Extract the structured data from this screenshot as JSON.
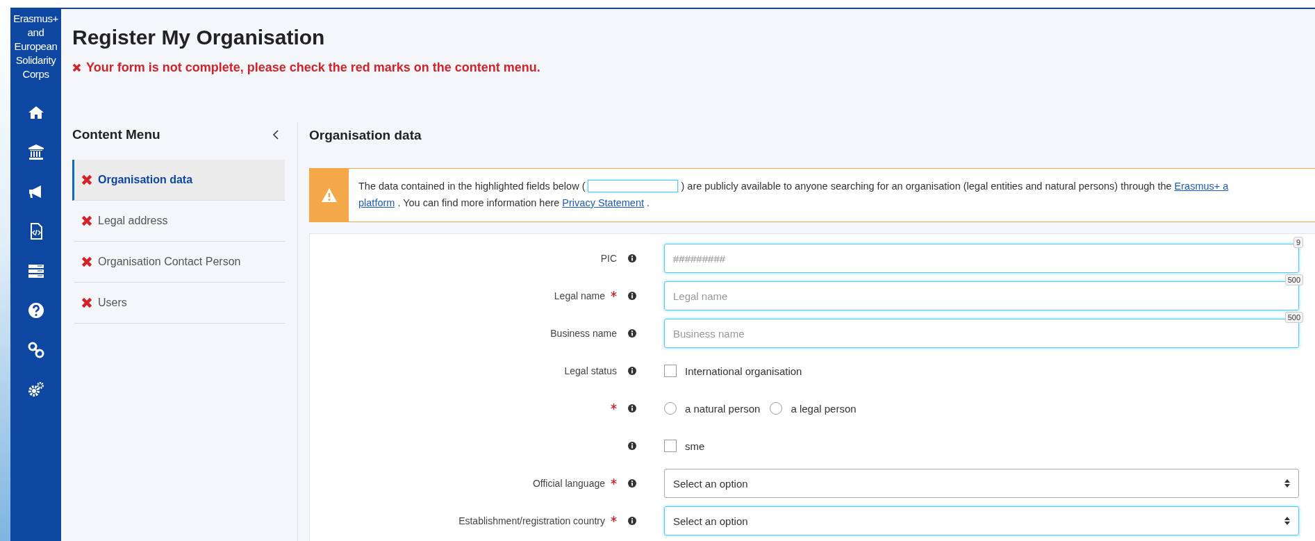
{
  "sidebar": {
    "brand": "Erasmus+ and European Solidarity Corps"
  },
  "page": {
    "title": "Register My Organisation",
    "error": "Your form is not complete, please check the red marks on the content menu."
  },
  "content_menu": {
    "title": "Content Menu",
    "items": [
      {
        "label": "Organisation data",
        "selected": true,
        "error": true
      },
      {
        "label": "Legal address",
        "selected": false,
        "error": true
      },
      {
        "label": "Organisation Contact Person",
        "selected": false,
        "error": true
      },
      {
        "label": "Users",
        "selected": false,
        "error": true
      }
    ]
  },
  "section": {
    "title": "Organisation data",
    "notice": {
      "line1_before": "The data contained in the highlighted fields below (",
      "line1_after": ") are publicly available to anyone searching for an organisation (legal entities and natural persons) through the",
      "link1": "Erasmus+ a",
      "link2": "platform",
      "line2_middle": ". You can find more information here",
      "link3": "Privacy Statement",
      "line2_end": "."
    },
    "fields": [
      {
        "kind": "text",
        "label": "PIC",
        "required": false,
        "placeholder": "#########",
        "counter": "9",
        "public": true
      },
      {
        "kind": "text",
        "label": "Legal name",
        "required": true,
        "placeholder": "Legal name",
        "counter": "500",
        "public": true
      },
      {
        "kind": "text",
        "label": "Business name",
        "required": false,
        "placeholder": "Business name",
        "counter": "500",
        "public": true
      },
      {
        "kind": "checkbox",
        "label": "Legal status",
        "required": false,
        "options": [
          {
            "label": "International organisation",
            "checked": false
          }
        ]
      },
      {
        "kind": "radio",
        "required": true,
        "options": [
          {
            "label": "a natural person",
            "selected": false
          },
          {
            "label": "a legal person",
            "selected": false
          }
        ]
      },
      {
        "kind": "checkbox",
        "required": false,
        "options": [
          {
            "label": "sme",
            "checked": false
          }
        ]
      },
      {
        "kind": "select",
        "label": "Official language",
        "required": true,
        "value": "Select an option",
        "public": false
      },
      {
        "kind": "select",
        "label": "Establishment/registration country",
        "required": true,
        "value": "Select an option",
        "public": true
      }
    ]
  }
}
